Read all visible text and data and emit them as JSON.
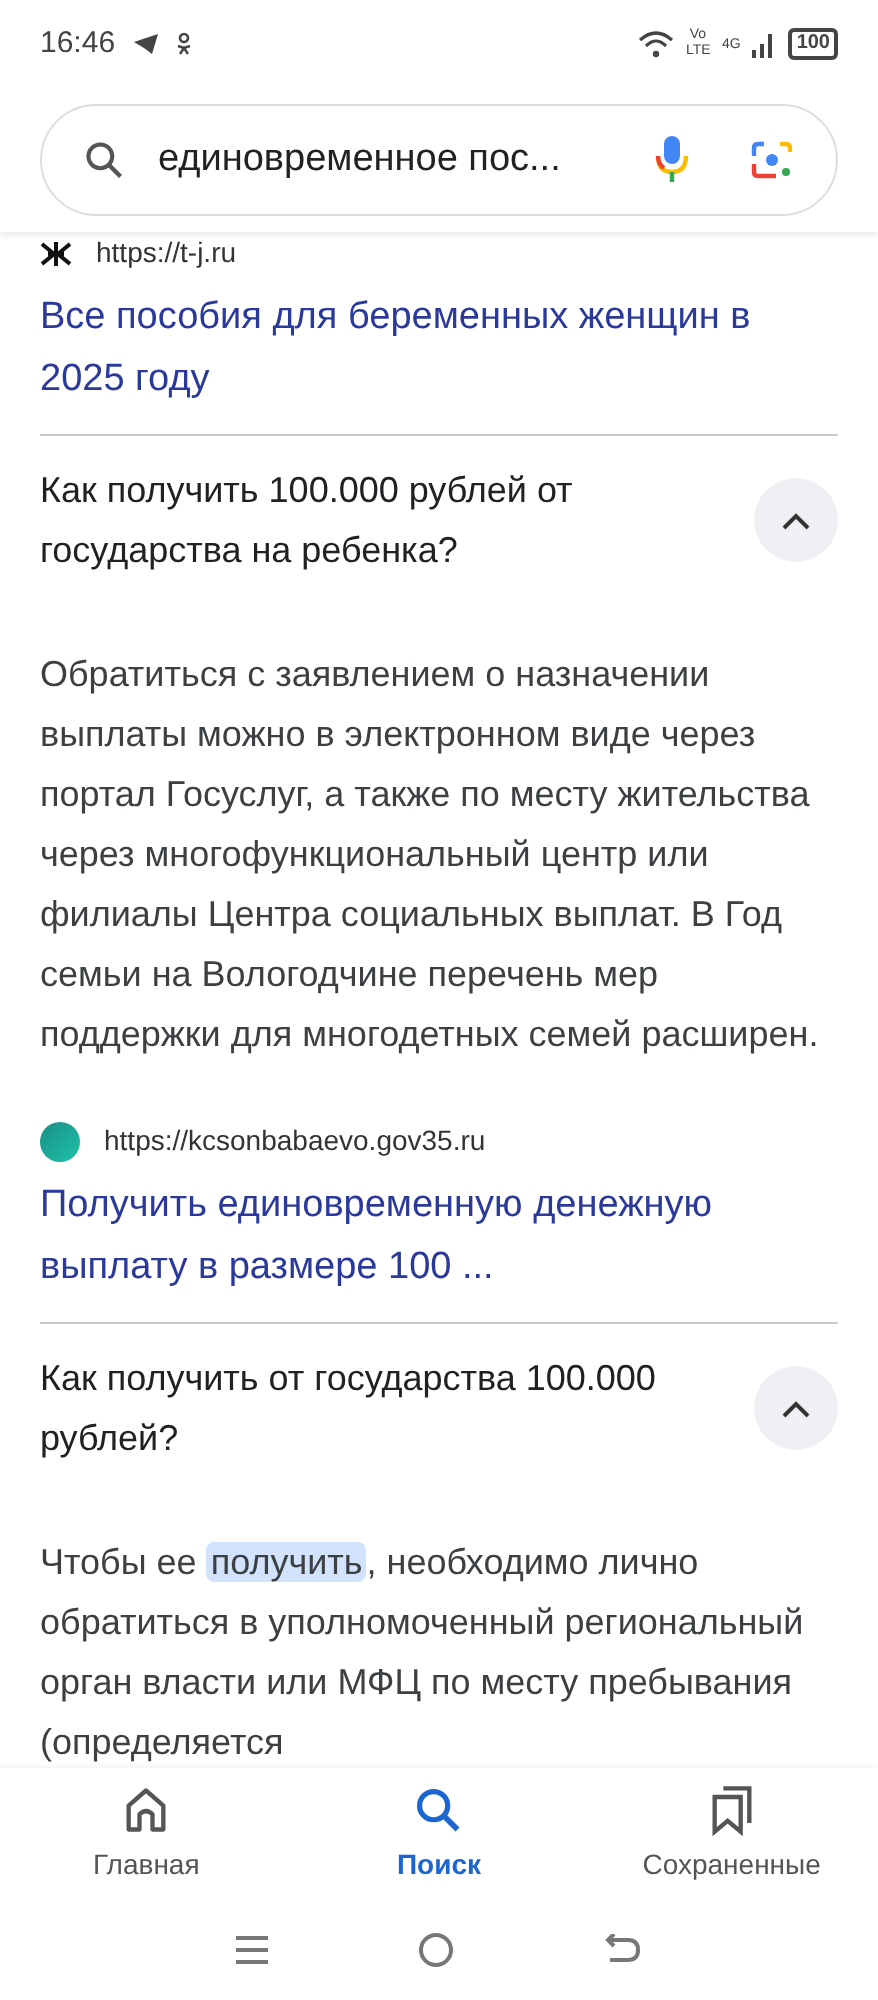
{
  "status_bar": {
    "time": "16:46",
    "battery": "100",
    "network": "4G",
    "volte": "Vo LTE"
  },
  "search": {
    "value": "единовременное пос..."
  },
  "results": [
    {
      "kind": "link",
      "source": "https://t-j.ru",
      "title": "Все пособия для беременных женщин в 2025 году"
    },
    {
      "kind": "faq",
      "question": "Как получить 100.000 рублей от государства на ребенка?",
      "expanded": true,
      "segments": [
        {
          "text": "Обратиться с заявлением о назначении выплаты можно в электронном виде через портал Госуслуг, а также по месту жительства через многофункциональный центр или филиалы Центра социальных выплат. В Год семьи на Вологодчине перечень мер поддержки для многодетных семей расширен.",
          "highlighted": false
        }
      ]
    },
    {
      "kind": "link",
      "source": "https://kcsonbabaevo.gov35.ru",
      "title": "Получить единовременную денежную выплату в размере 100 ..."
    },
    {
      "kind": "faq",
      "question": "Как получить от государства 100.000 рублей?",
      "expanded": true,
      "segments": [
        {
          "text": "Чтобы ее ",
          "highlighted": false
        },
        {
          "text": "получить",
          "highlighted": true
        },
        {
          "text": ", необходимо лично обратиться в уполномоченный региональный орган власти или МФЦ по месту пребывания (определяется",
          "highlighted": false
        }
      ]
    }
  ],
  "bottom_nav": [
    {
      "label": "Главная",
      "selected": false
    },
    {
      "label": "Поиск",
      "selected": true
    },
    {
      "label": "Сохраненные",
      "selected": false
    }
  ]
}
